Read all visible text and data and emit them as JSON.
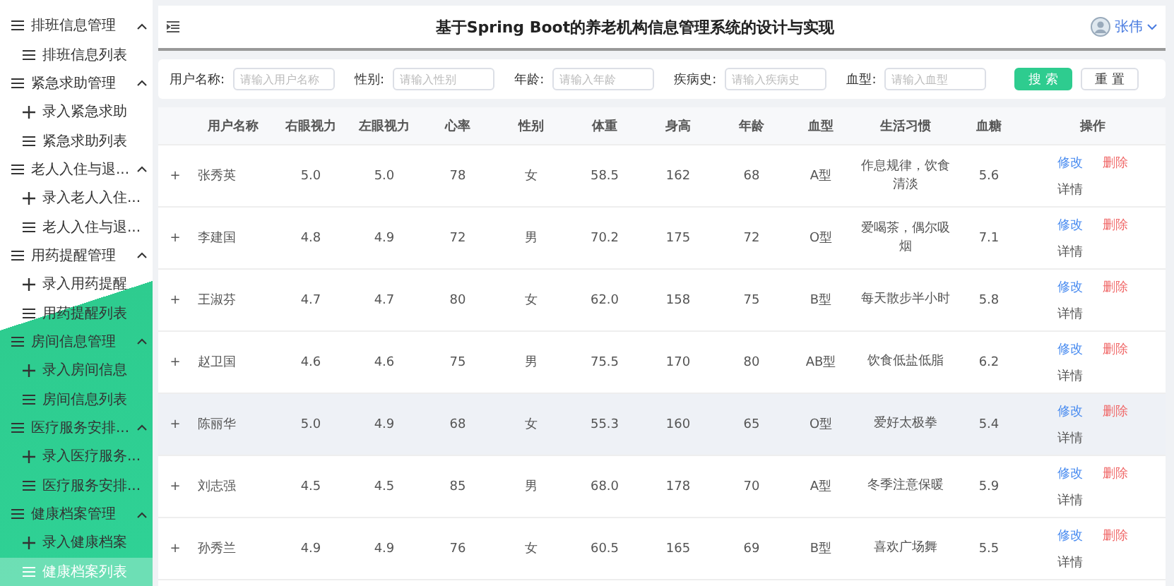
{
  "sidebar": {
    "groups": [
      {
        "title": "排班信息管理",
        "expanded": true,
        "children": [
          {
            "kind": "list",
            "label": "排班信息列表",
            "selected": false
          }
        ]
      },
      {
        "title": "紧急求助管理",
        "expanded": true,
        "children": [
          {
            "kind": "add",
            "label": "录入紧急求助",
            "selected": false
          },
          {
            "kind": "list",
            "label": "紧急求助列表",
            "selected": false
          }
        ]
      },
      {
        "title": "老人入住与退...",
        "expanded": true,
        "children": [
          {
            "kind": "add",
            "label": "录入老人入住...",
            "selected": false
          },
          {
            "kind": "list",
            "label": "老人入住与退...",
            "selected": false
          }
        ]
      },
      {
        "title": "用药提醒管理",
        "expanded": true,
        "children": [
          {
            "kind": "add",
            "label": "录入用药提醒",
            "selected": false
          },
          {
            "kind": "list",
            "label": "用药提醒列表",
            "selected": false
          }
        ]
      },
      {
        "title": "房间信息管理",
        "expanded": true,
        "children": [
          {
            "kind": "add",
            "label": "录入房间信息",
            "selected": false
          },
          {
            "kind": "list",
            "label": "房间信息列表",
            "selected": false
          }
        ]
      },
      {
        "title": "医疗服务安排...",
        "expanded": true,
        "children": [
          {
            "kind": "add",
            "label": "录入医疗服务...",
            "selected": false
          },
          {
            "kind": "list",
            "label": "医疗服务安排...",
            "selected": false
          }
        ]
      },
      {
        "title": "健康档案管理",
        "expanded": true,
        "children": [
          {
            "kind": "add",
            "label": "录入健康档案",
            "selected": false
          },
          {
            "kind": "list",
            "label": "健康档案列表",
            "selected": true
          }
        ]
      }
    ]
  },
  "header": {
    "title": "基于Spring Boot的养老机构信息管理系统的设计与实现",
    "user": "张伟"
  },
  "search": {
    "fields": [
      {
        "label": "用户名称:",
        "placeholder": "请输入用户名称"
      },
      {
        "label": "性别:",
        "placeholder": "请输入性别"
      },
      {
        "label": "年龄:",
        "placeholder": "请输入年龄"
      },
      {
        "label": "疾病史:",
        "placeholder": "请输入疾病史"
      },
      {
        "label": "血型:",
        "placeholder": "请输入血型"
      }
    ],
    "buttons": [
      {
        "kind": "primary",
        "label": "搜 索"
      },
      {
        "kind": "plain",
        "label": "重 置"
      }
    ]
  },
  "table": {
    "columns": [
      "用户名称",
      "右眼视力",
      "左眼视力",
      "心率",
      "性别",
      "体重",
      "身高",
      "年龄",
      "血型",
      "生活习惯",
      "血糖",
      "操作"
    ],
    "rows": [
      {
        "expand": "+",
        "hovered": false,
        "cells": [
          "张秀英",
          "5.0",
          "5.0",
          "78",
          "女",
          "58.5",
          "162",
          "68",
          "A型",
          "作息规律，饮食清淡",
          "5.6"
        ],
        "actions": [
          "修改",
          "删除",
          "详情"
        ]
      },
      {
        "expand": "+",
        "hovered": false,
        "cells": [
          "李建国",
          "4.8",
          "4.9",
          "72",
          "男",
          "70.2",
          "175",
          "72",
          "O型",
          "爱喝茶，偶尔吸烟",
          "7.1"
        ],
        "actions": [
          "修改",
          "删除",
          "详情"
        ]
      },
      {
        "expand": "+",
        "hovered": false,
        "cells": [
          "王淑芬",
          "4.7",
          "4.7",
          "80",
          "女",
          "62.0",
          "158",
          "75",
          "B型",
          "每天散步半小时",
          "5.8"
        ],
        "actions": [
          "修改",
          "删除",
          "详情"
        ]
      },
      {
        "expand": "+",
        "hovered": false,
        "cells": [
          "赵卫国",
          "4.6",
          "4.6",
          "75",
          "男",
          "75.5",
          "170",
          "80",
          "AB型",
          "饮食低盐低脂",
          "6.2"
        ],
        "actions": [
          "修改",
          "删除",
          "详情"
        ]
      },
      {
        "expand": "+",
        "hovered": true,
        "cells": [
          "陈丽华",
          "5.0",
          "4.9",
          "68",
          "女",
          "55.3",
          "160",
          "65",
          "O型",
          "爱好太极拳",
          "5.4"
        ],
        "actions": [
          "修改",
          "删除",
          "详情"
        ]
      },
      {
        "expand": "+",
        "hovered": false,
        "cells": [
          "刘志强",
          "4.5",
          "4.5",
          "85",
          "男",
          "68.0",
          "178",
          "70",
          "A型",
          "冬季注意保暖",
          "5.9"
        ],
        "actions": [
          "修改",
          "删除",
          "详情"
        ]
      },
      {
        "expand": "+",
        "hovered": false,
        "cells": [
          "孙秀兰",
          "4.9",
          "4.9",
          "76",
          "女",
          "60.5",
          "165",
          "69",
          "B型",
          "喜欢广场舞",
          "5.5"
        ],
        "actions": [
          "修改",
          "删除",
          "详情"
        ]
      }
    ]
  }
}
